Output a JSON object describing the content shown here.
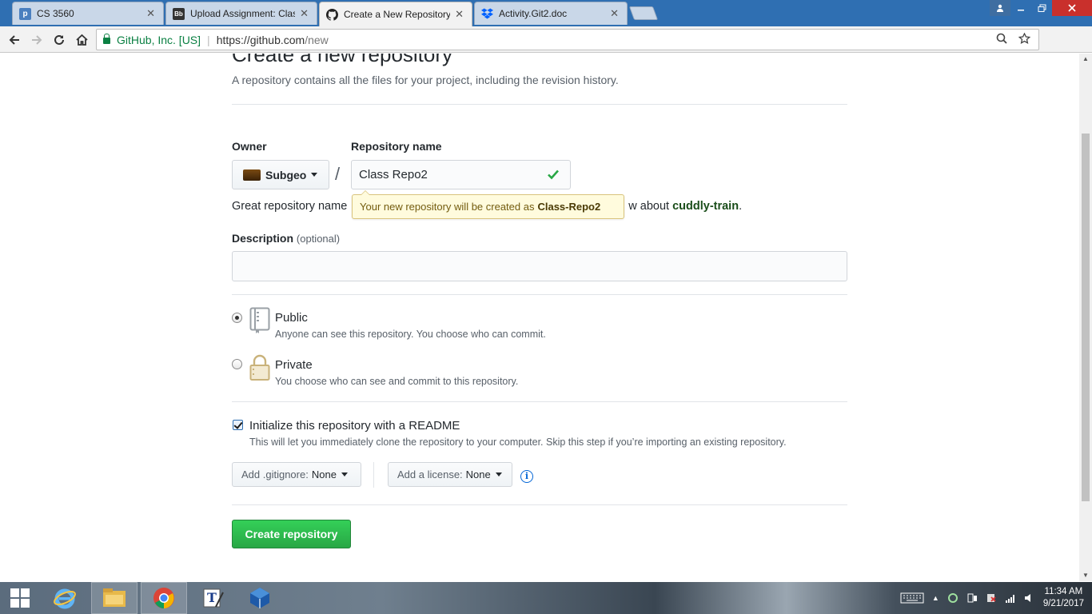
{
  "browser": {
    "tabs": [
      {
        "title": "CS 3560",
        "icon": "p-icon",
        "active": false
      },
      {
        "title": "Upload Assignment: Clas",
        "icon": "blackboard-icon",
        "active": false
      },
      {
        "title": "Create a New Repository",
        "icon": "github-icon",
        "active": true
      },
      {
        "title": "Activity.Git2.doc",
        "icon": "dropbox-icon",
        "active": false
      }
    ],
    "close_glyph": "✕",
    "security_label": "GitHub, Inc. [US]",
    "url_scheme": "https://github.com",
    "url_path": "/new"
  },
  "page": {
    "title": "Create a new repository",
    "subtitle": "A repository contains all the files for your project, including the revision history.",
    "owner_label": "Owner",
    "owner_name": "Subgeo",
    "slash": "/",
    "repo_name_label": "Repository name",
    "repo_name_value": "Class Repo2",
    "hint_prefix": "Great repository name",
    "hint_middle": "w about",
    "hint_suggestion": "cuddly-train",
    "hint_end": ".",
    "tooltip_text": "Your new repository will be created as",
    "tooltip_name": "Class-Repo2",
    "description_label": "Description",
    "description_optional": "(optional)",
    "description_value": "",
    "public_title": "Public",
    "public_note": "Anyone can see this repository. You choose who can commit.",
    "private_title": "Private",
    "private_note": "You choose who can see and commit to this repository.",
    "selected_visibility": "Public",
    "readme_title": "Initialize this repository with a README",
    "readme_note": "This will let you immediately clone the repository to your computer. Skip this step if you’re importing an existing repository.",
    "readme_checked": true,
    "gitignore_label": "Add .gitignore:",
    "gitignore_value": "None",
    "license_label": "Add a license:",
    "license_value": "None",
    "create_button": "Create repository"
  },
  "taskbar": {
    "time": "11:34 AM",
    "date": "9/21/2017",
    "pinned": [
      "internet-explorer-icon",
      "file-explorer-icon",
      "chrome-icon",
      "text-editor-icon",
      "virtualbox-icon"
    ]
  },
  "colors": {
    "accent_green": "#28a745",
    "tooltip_bg": "#fffbdd",
    "chrome_frame": "#2f6fb2"
  }
}
